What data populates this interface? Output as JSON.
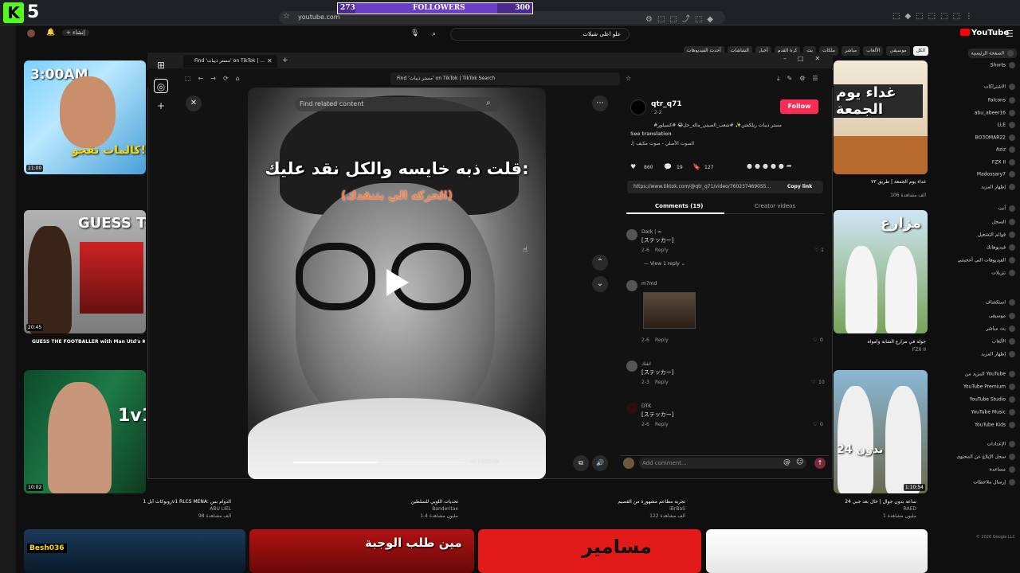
{
  "overlay_widget": {
    "left_count": "273",
    "label": "FOLLOWERS",
    "right_count": "300",
    "progress": 0.91
  },
  "browser": {
    "url": "youtube.com"
  },
  "youtube": {
    "search_value": "علو اعلى شيلات",
    "logo": "YouTube",
    "chips": [
      "الكل",
      "موسيقى",
      "الألعاب",
      "مباشر",
      "ملكات",
      "بث",
      "كرة القدم",
      "أخبار",
      "الشاشات",
      "أحدث الفيديوهات"
    ],
    "sidebar": [
      {
        "label": "الصفحة الرئيسية",
        "active": true
      },
      {
        "label": "Shorts"
      },
      {
        "label": "الاشتراكات"
      },
      {
        "label": "Falcons"
      },
      {
        "label": "abu_abeer16"
      },
      {
        "label": "LLE"
      },
      {
        "label": "BO3OMAR22"
      },
      {
        "label": "Aziz"
      },
      {
        "label": "FZX II"
      },
      {
        "label": "Madossary7"
      },
      {
        "label": "إظهار المزيد"
      },
      {
        "label": "أنت"
      },
      {
        "label": "السجل"
      },
      {
        "label": "قوائم التشغيل"
      },
      {
        "label": "فيديوهاتك"
      },
      {
        "label": "الفيديوهات التي أعجبتني"
      },
      {
        "label": "تنزيلات"
      },
      {
        "label": "استكشاف"
      },
      {
        "label": "موسيقى"
      },
      {
        "label": "بث مباشر"
      },
      {
        "label": "الألعاب"
      },
      {
        "label": "إظهار المزيد"
      },
      {
        "label": "المزيد من YouTube"
      },
      {
        "label": "YouTube Premium"
      },
      {
        "label": "YouTube Studio"
      },
      {
        "label": "YouTube Music"
      },
      {
        "label": "YouTube Kids"
      },
      {
        "label": "الإعدادات"
      },
      {
        "label": "سجل الإبلاغ عن المحتوى"
      },
      {
        "label": "مساعدة"
      },
      {
        "label": "إرسال ملاحظات"
      }
    ],
    "copyright": "© 2026 Google LLC",
    "videos_left": [
      {
        "thumb_text": "3:00AM",
        "sub_text": "كالمات تفجو!",
        "duration": "21:00"
      },
      {
        "thumb_text": "GUESS THE FOOTBA",
        "duration": "20:45",
        "title": "GUESS THE FOOTBALLER with Man Utd's Kobbie M"
      },
      {
        "thumb_text": "1v1",
        "duration": "10:02"
      }
    ],
    "videos_right": [
      {
        "thumb_text": "غداء يوم الجمعة",
        "title": "غداء يوم الجمعة | طريق ٧٣",
        "meta": "106 ألف مشاهدة"
      },
      {
        "thumb_text": "مزارع",
        "title": "جولة في مزارع الشابة وأمواه",
        "meta": "FZX II"
      },
      {
        "thumb_text": "24 بدون",
        "duration": "1:10:54",
        "title": "24 ساعة بدون جوال ...",
        "meta": "RAED"
      }
    ],
    "bottom_row_titles": [
      {
        "title": "روبوكات أبل 1v1 RLCS MENA: الدوام بس",
        "channel": "ABU LIEL",
        "meta": "98 ألف مشاهدة"
      },
      {
        "title": "تحديات اللوبي للسلطين",
        "channel": "Banderitax",
        "meta": "1.4 مليون مشاهدة"
      },
      {
        "title": "تجربة مطاعم مشهورة من القصيم",
        "channel": "iBrBaS",
        "meta": "122 ألف مشاهدة"
      },
      {
        "title": "24 ساعة بدون جوال | خال بعد جبي",
        "channel": "RAED",
        "meta": "1 مليون مشاهدة"
      }
    ],
    "bottom_thumbs": [
      "Besh036",
      "مين طلب الوجبة",
      "مسامير",
      ""
    ]
  },
  "tiktok": {
    "tab_title": "Find 'مستر ذيبات' on TikTok | ...",
    "url": "Find 'مستر ذيبات' on TikTok | TikTok Search",
    "search_placeholder": "Find related content",
    "caption_white": "قلت ذبه خايسه والكل نقد عليك:",
    "caption_orange": "(الحركه الي بتنقدك)",
    "time": "00:04/00:08",
    "progress": 0.49,
    "author": {
      "username": "qtr_q71",
      "date": "· 2-2"
    },
    "follow_label": "Follow",
    "description": "#مستر ذيبات ريلكشن✨ #شعب_الصيني_ماله_حل😂 #كسبلور",
    "see_translation": "See translation",
    "sound": "♫ الصوت الأصلي - صوت مكيف",
    "stats": {
      "likes": "860",
      "comments": "19",
      "saves": "127"
    },
    "link": "https://www.tiktok.com/@qtr_q71/video/7602374690S5...",
    "copy_link": "Copy link",
    "tab_comments": "Comments (19)",
    "tab_creator": "Creator videos",
    "comments": [
      {
        "name": "Dark | ∞",
        "text": "[ステッカー]",
        "date": "2-6",
        "reply": "Reply",
        "likes": "1",
        "view_replies": "View 1 reply"
      },
      {
        "name": "m7md",
        "text": "",
        "date": "2-6",
        "reply": "Reply",
        "likes": "0",
        "has_image": true
      },
      {
        "name": "اشك",
        "text": "[ステッカー]",
        "date": "2-3",
        "reply": "Reply",
        "likes": "10"
      },
      {
        "name": "DTK",
        "text": "[ステッカー]",
        "date": "2-6",
        "reply": "Reply",
        "likes": "0"
      }
    ],
    "add_comment": "Add comment..."
  }
}
